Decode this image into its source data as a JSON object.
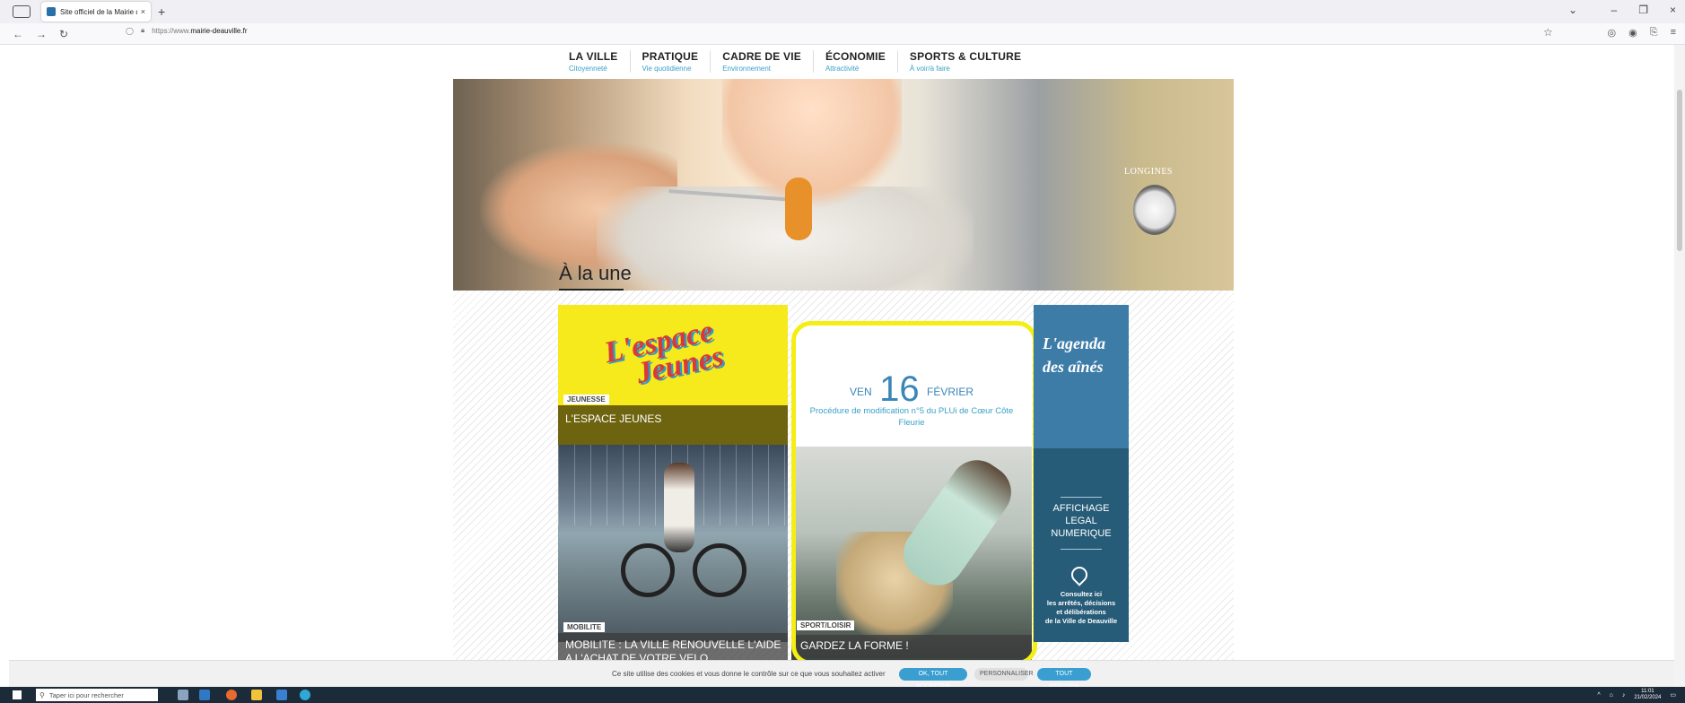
{
  "browser": {
    "tab_title": "Site officiel de la Mairie de Deauville",
    "tab_close": "×",
    "new_tab": "+",
    "url_prefix": "https://www.",
    "url_domain": "mairie-deauville.fr",
    "back": "←",
    "forward": "→",
    "reload": "↻",
    "bookmark": "☆"
  },
  "window": {
    "minimize": "–",
    "maximize": "❐",
    "close": "×",
    "list_tabs": "⌄"
  },
  "menu": [
    {
      "main": "LA VILLE",
      "sub": "Citoyenneté"
    },
    {
      "main": "PRATIQUE",
      "sub": "Vie quotidienne"
    },
    {
      "main": "CADRE DE VIE",
      "sub": "Environnement"
    },
    {
      "main": "ÉCONOMIE",
      "sub": "Attractivité"
    },
    {
      "main": "SPORTS & CULTURE",
      "sub": "À voir/à faire"
    }
  ],
  "hero": {
    "brand": "LONGINES"
  },
  "alaune": {
    "title": "À la une"
  },
  "cards": {
    "jeunes": {
      "logo_line1": "L'espace",
      "logo_line2": "Jeunes",
      "tag": "JEUNESSE",
      "title": "L'ESPACE JEUNES"
    },
    "mobilite": {
      "tag": "MOBILITE",
      "title_line1": "MOBILITE : LA VILLE RENOUVELLE L'AIDE",
      "title_line2": "A L'ACHAT DE VOTRE VELO"
    },
    "event": {
      "day_name": "VEN",
      "day_num": "16",
      "month": "FÉVRIER",
      "desc": "Procédure de modification n°5 du PLUi de Cœur Côte Fleurie"
    },
    "forme": {
      "tag": "SPORT/LOISIR",
      "title": "GARDEZ LA FORME !"
    },
    "agenda": {
      "title_line1": "L'agenda",
      "title_line2": "des aînés"
    },
    "affichage": {
      "title_line1": "AFFICHAGE",
      "title_line2": "LEGAL",
      "title_line3": "NUMERIQUE",
      "desc_line1": "Consultez ici",
      "desc_line2": "les arrêtés, décisions",
      "desc_line3": "et délibérations",
      "desc_line4": "de la Ville de Deauville"
    }
  },
  "cookie": {
    "text": "Ce site utilise des cookies et vous donne le contrôle sur ce que vous souhaitez activer",
    "accept": "OK, TOUT ACCEPTER",
    "personalize": "PERSONNALISER",
    "refuse": "TOUT REFUSER"
  },
  "taskbar": {
    "search_placeholder": "Taper ici pour rechercher",
    "time": "11:01",
    "date": "21/02/2024"
  },
  "colors": {
    "accent_blue": "#3a86b8",
    "highlight_yellow": "#f4ee12",
    "jeunes_yellow": "#f6e91c",
    "agenda_blue": "#3e7ca8"
  }
}
